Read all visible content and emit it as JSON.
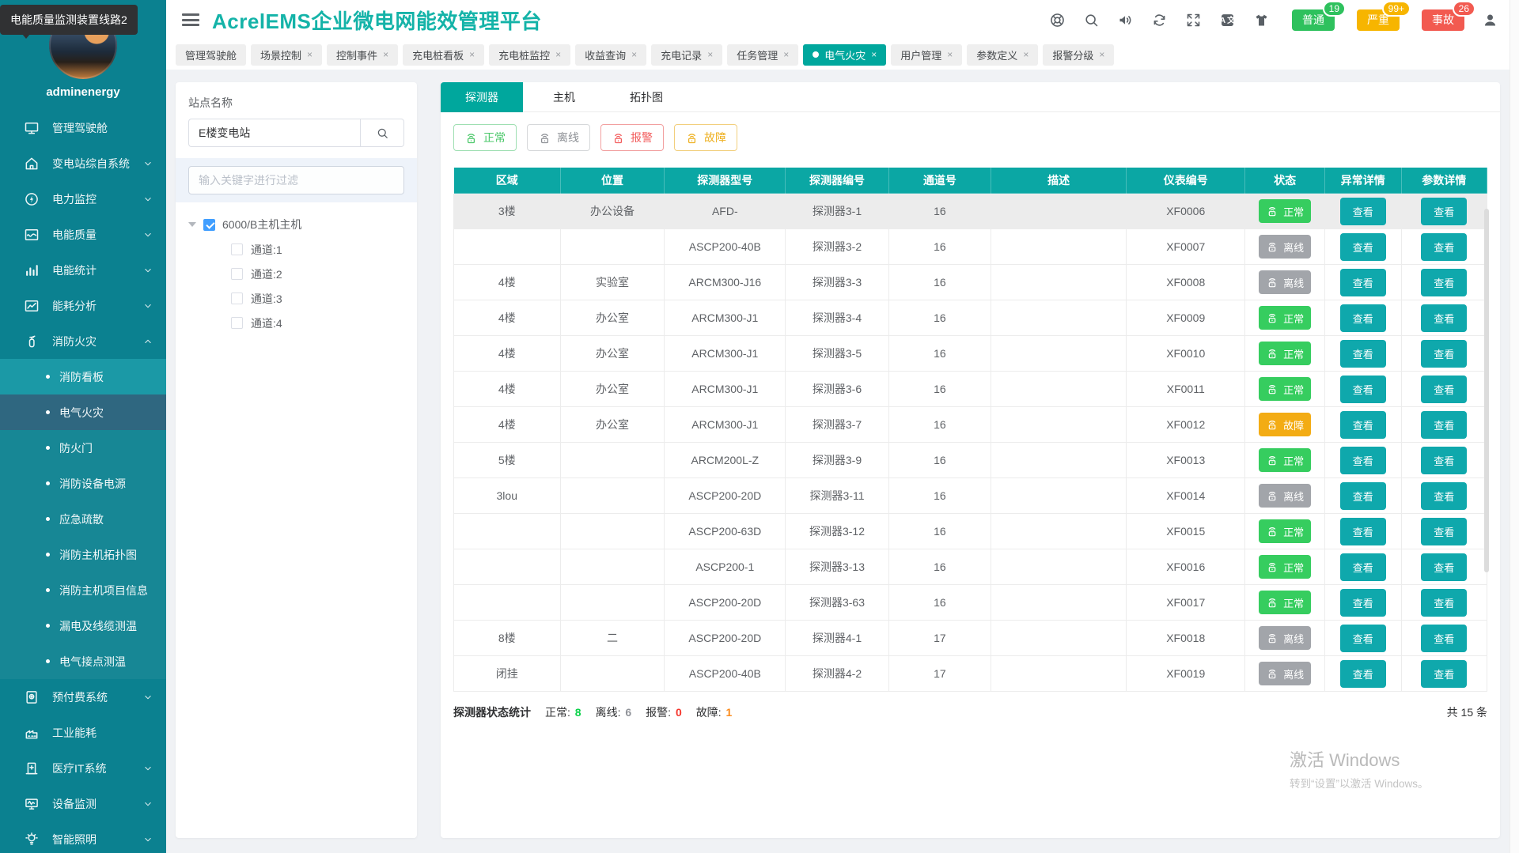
{
  "tooltip": "电能质量监测装置线路2",
  "sidebar": {
    "username": "adminenergy",
    "items": [
      {
        "type": "top",
        "id": "dashboard",
        "icon": "monitor",
        "label": "管理驾驶舱",
        "chevron": null
      },
      {
        "type": "top",
        "id": "substation-system",
        "icon": "home",
        "label": "变电站综自系统",
        "chevron": "down"
      },
      {
        "type": "top",
        "id": "power-monitor",
        "icon": "bolt",
        "label": "电力监控",
        "chevron": "down"
      },
      {
        "type": "top",
        "id": "power-quality",
        "icon": "wave",
        "label": "电能质量",
        "chevron": "down"
      },
      {
        "type": "top",
        "id": "power-stats",
        "icon": "bars",
        "label": "电能统计",
        "chevron": "down"
      },
      {
        "type": "top",
        "id": "energy-analysis",
        "icon": "trend",
        "label": "能耗分析",
        "chevron": "down"
      },
      {
        "type": "top",
        "id": "fire-safety",
        "icon": "extinguisher",
        "label": "消防火灾",
        "chevron": "up"
      },
      {
        "type": "sub",
        "id": "fire-board",
        "label": "消防看板",
        "state": "hl"
      },
      {
        "type": "sub",
        "id": "electrical-fire",
        "label": "电气火灾",
        "state": "active"
      },
      {
        "type": "sub",
        "id": "fire-door",
        "label": "防火门",
        "state": ""
      },
      {
        "type": "sub",
        "id": "fire-equipment-power",
        "label": "消防设备电源",
        "state": ""
      },
      {
        "type": "sub",
        "id": "emergency-evacuation",
        "label": "应急疏散",
        "state": ""
      },
      {
        "type": "sub",
        "id": "fire-host-topology",
        "label": "消防主机拓扑图",
        "state": ""
      },
      {
        "type": "sub",
        "id": "fire-host-info",
        "label": "消防主机项目信息",
        "state": ""
      },
      {
        "type": "sub",
        "id": "leakage-cable-temp",
        "label": "漏电及线缆测温",
        "state": ""
      },
      {
        "type": "sub",
        "id": "electrical-contact-temp",
        "label": "电气接点测温",
        "state": ""
      },
      {
        "type": "top",
        "id": "prepaid-system",
        "icon": "wallet",
        "label": "预付费系统",
        "chevron": "down"
      },
      {
        "type": "top",
        "id": "industrial-energy",
        "icon": "factory",
        "label": "工业能耗",
        "chevron": null
      },
      {
        "type": "top",
        "id": "medical-it",
        "icon": "hospital",
        "label": "医疗IT系统",
        "chevron": "down"
      },
      {
        "type": "top",
        "id": "device-monitor",
        "icon": "device",
        "label": "设备监测",
        "chevron": "down"
      },
      {
        "type": "top",
        "id": "smart-lighting",
        "icon": "bulb",
        "label": "智能照明",
        "chevron": "down"
      }
    ]
  },
  "header": {
    "title": "AcrelEMS企业微电网能效管理平台",
    "icons": [
      "lifebuoy",
      "search",
      "speaker",
      "refresh",
      "expand",
      "translate",
      "tshirt"
    ],
    "badges": [
      {
        "label": "普通",
        "count": "19",
        "type": "normal",
        "color": "#2ec15d"
      },
      {
        "label": "严重",
        "count": "99+",
        "type": "severe",
        "color": "#f7b500"
      },
      {
        "label": "事故",
        "count": "26",
        "type": "accident",
        "color": "#f25a50"
      }
    ],
    "user_icon": "user"
  },
  "tabbar": {
    "tabs": [
      {
        "label": "管理驾驶舱",
        "closable": false,
        "active": false
      },
      {
        "label": "场景控制",
        "closable": true,
        "active": false
      },
      {
        "label": "控制事件",
        "closable": true,
        "active": false
      },
      {
        "label": "充电桩看板",
        "closable": true,
        "active": false
      },
      {
        "label": "充电桩监控",
        "closable": true,
        "active": false
      },
      {
        "label": "收益查询",
        "closable": true,
        "active": false
      },
      {
        "label": "充电记录",
        "closable": true,
        "active": false
      },
      {
        "label": "任务管理",
        "closable": true,
        "active": false
      },
      {
        "label": "电气火灾",
        "closable": true,
        "active": true
      },
      {
        "label": "用户管理",
        "closable": true,
        "active": false
      },
      {
        "label": "参数定义",
        "closable": true,
        "active": false
      },
      {
        "label": "报警分级",
        "closable": true,
        "active": false
      }
    ]
  },
  "station_panel": {
    "title_label": "站点名称",
    "station_value": "E楼变电站",
    "filter_placeholder": "输入关键字进行过滤",
    "tree": {
      "root_label": "6000/B主机主机",
      "root_checked": true,
      "children": [
        {
          "label": "通道:1",
          "checked": false
        },
        {
          "label": "通道:2",
          "checked": false
        },
        {
          "label": "通道:3",
          "checked": false
        },
        {
          "label": "通道:4",
          "checked": false
        }
      ]
    }
  },
  "detector_panel": {
    "tabs": [
      {
        "label": "探测器",
        "active": true
      },
      {
        "label": "主机",
        "active": false
      },
      {
        "label": "拓扑图",
        "active": false
      }
    ],
    "filters": [
      {
        "label": "正常",
        "type": "normal"
      },
      {
        "label": "离线",
        "type": "offline"
      },
      {
        "label": "报警",
        "type": "alarm"
      },
      {
        "label": "故障",
        "type": "fault"
      }
    ],
    "status_labels": {
      "normal": "正常",
      "offline": "离线",
      "alarm": "报警",
      "fault": "故障"
    },
    "view_label": "查看",
    "table": {
      "headers": [
        "区域",
        "位置",
        "探测器型号",
        "探测器编号",
        "通道号",
        "描述",
        "仪表编号",
        "状态",
        "异常详情",
        "参数详情"
      ],
      "rows": [
        {
          "cells": [
            "3楼",
            "办公设备",
            "AFD-",
            "探测器3-1",
            "16",
            "",
            "XF0006"
          ],
          "status": "normal",
          "highlight": true
        },
        {
          "cells": [
            "",
            "",
            "ASCP200-40B",
            "探测器3-2",
            "16",
            "",
            "XF0007"
          ],
          "status": "offline",
          "highlight": false
        },
        {
          "cells": [
            "4楼",
            "实验室",
            "ARCM300-J16",
            "探测器3-3",
            "16",
            "",
            "XF0008"
          ],
          "status": "offline",
          "highlight": false
        },
        {
          "cells": [
            "4楼",
            "办公室",
            "ARCM300-J1",
            "探测器3-4",
            "16",
            "",
            "XF0009"
          ],
          "status": "normal",
          "highlight": false
        },
        {
          "cells": [
            "4楼",
            "办公室",
            "ARCM300-J1",
            "探测器3-5",
            "16",
            "",
            "XF0010"
          ],
          "status": "normal",
          "highlight": false
        },
        {
          "cells": [
            "4楼",
            "办公室",
            "ARCM300-J1",
            "探测器3-6",
            "16",
            "",
            "XF0011"
          ],
          "status": "normal",
          "highlight": false
        },
        {
          "cells": [
            "4楼",
            "办公室",
            "ARCM300-J1",
            "探测器3-7",
            "16",
            "",
            "XF0012"
          ],
          "status": "fault",
          "highlight": false
        },
        {
          "cells": [
            "5楼",
            "",
            "ARCM200L-Z",
            "探测器3-9",
            "16",
            "",
            "XF0013"
          ],
          "status": "normal",
          "highlight": false
        },
        {
          "cells": [
            "3lou",
            "",
            "ASCP200-20D",
            "探测器3-11",
            "16",
            "",
            "XF0014"
          ],
          "status": "offline",
          "highlight": false
        },
        {
          "cells": [
            "",
            "",
            "ASCP200-63D",
            "探测器3-12",
            "16",
            "",
            "XF0015"
          ],
          "status": "normal",
          "highlight": false
        },
        {
          "cells": [
            "",
            "",
            "ASCP200-1",
            "探测器3-13",
            "16",
            "",
            "XF0016"
          ],
          "status": "normal",
          "highlight": false
        },
        {
          "cells": [
            "",
            "",
            "ASCP200-20D",
            "探测器3-63",
            "16",
            "",
            "XF0017"
          ],
          "status": "normal",
          "highlight": false
        },
        {
          "cells": [
            "8楼",
            "二",
            "ASCP200-20D",
            "探测器4-1",
            "17",
            "",
            "XF0018"
          ],
          "status": "offline",
          "highlight": false
        },
        {
          "cells": [
            "闭挂",
            "",
            "ASCP200-40B",
            "探测器4-2",
            "17",
            "",
            "XF0019"
          ],
          "status": "offline",
          "highlight": false
        }
      ]
    },
    "stats": {
      "title": "探测器状态统计",
      "items": [
        {
          "label": "正常",
          "value": "8",
          "color": "#0bd24a"
        },
        {
          "label": "离线",
          "value": "6",
          "color": "#909399"
        },
        {
          "label": "报警",
          "value": "0",
          "color": "#f5352c"
        },
        {
          "label": "故障",
          "value": "1",
          "color": "#fb8b1c"
        }
      ]
    },
    "total": "共 15 条"
  },
  "watermark": {
    "line1": "激活 Windows",
    "line2": "转到“设置”以激活 Windows。"
  },
  "colors": {
    "accent": "#0ba7a4",
    "sidebar": "#0b8190",
    "status_normal": "#36cd5f",
    "status_offline": "#a2a5aa",
    "status_fault": "#f3ac14",
    "status_alarm": "#f25a50",
    "title": "#14b3a8"
  }
}
